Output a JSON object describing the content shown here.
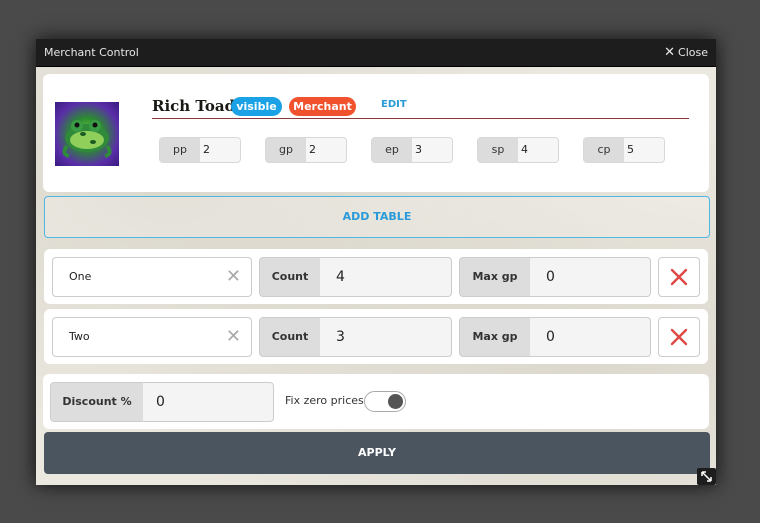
{
  "window": {
    "title": "Merchant Control",
    "close_label": "Close"
  },
  "merchant": {
    "name": "Rich Toad",
    "badge_visible": "visible",
    "badge_merchant": "Merchant",
    "edit_label": "EDIT",
    "avatar_icon": "frog-token-icon"
  },
  "coins": [
    {
      "label": "pp",
      "value": "2"
    },
    {
      "label": "gp",
      "value": "2"
    },
    {
      "label": "ep",
      "value": "3"
    },
    {
      "label": "sp",
      "value": "4"
    },
    {
      "label": "cp",
      "value": "5"
    }
  ],
  "add_table_label": "ADD TABLE",
  "tables": [
    {
      "name": "One",
      "count_label": "Count",
      "count": "4",
      "maxgp_label": "Max gp",
      "maxgp": "0"
    },
    {
      "name": "Two",
      "count_label": "Count",
      "count": "3",
      "maxgp_label": "Max gp",
      "maxgp": "0"
    }
  ],
  "discount": {
    "label": "Discount %",
    "value": "0"
  },
  "fix_zero": {
    "label": "Fix zero prices",
    "enabled": true
  },
  "apply_label": "APPLY",
  "colors": {
    "visible_badge": "#1aa1e6",
    "merchant_badge": "#f0522e",
    "delete": "#e04848",
    "apply": "#4b5560"
  }
}
